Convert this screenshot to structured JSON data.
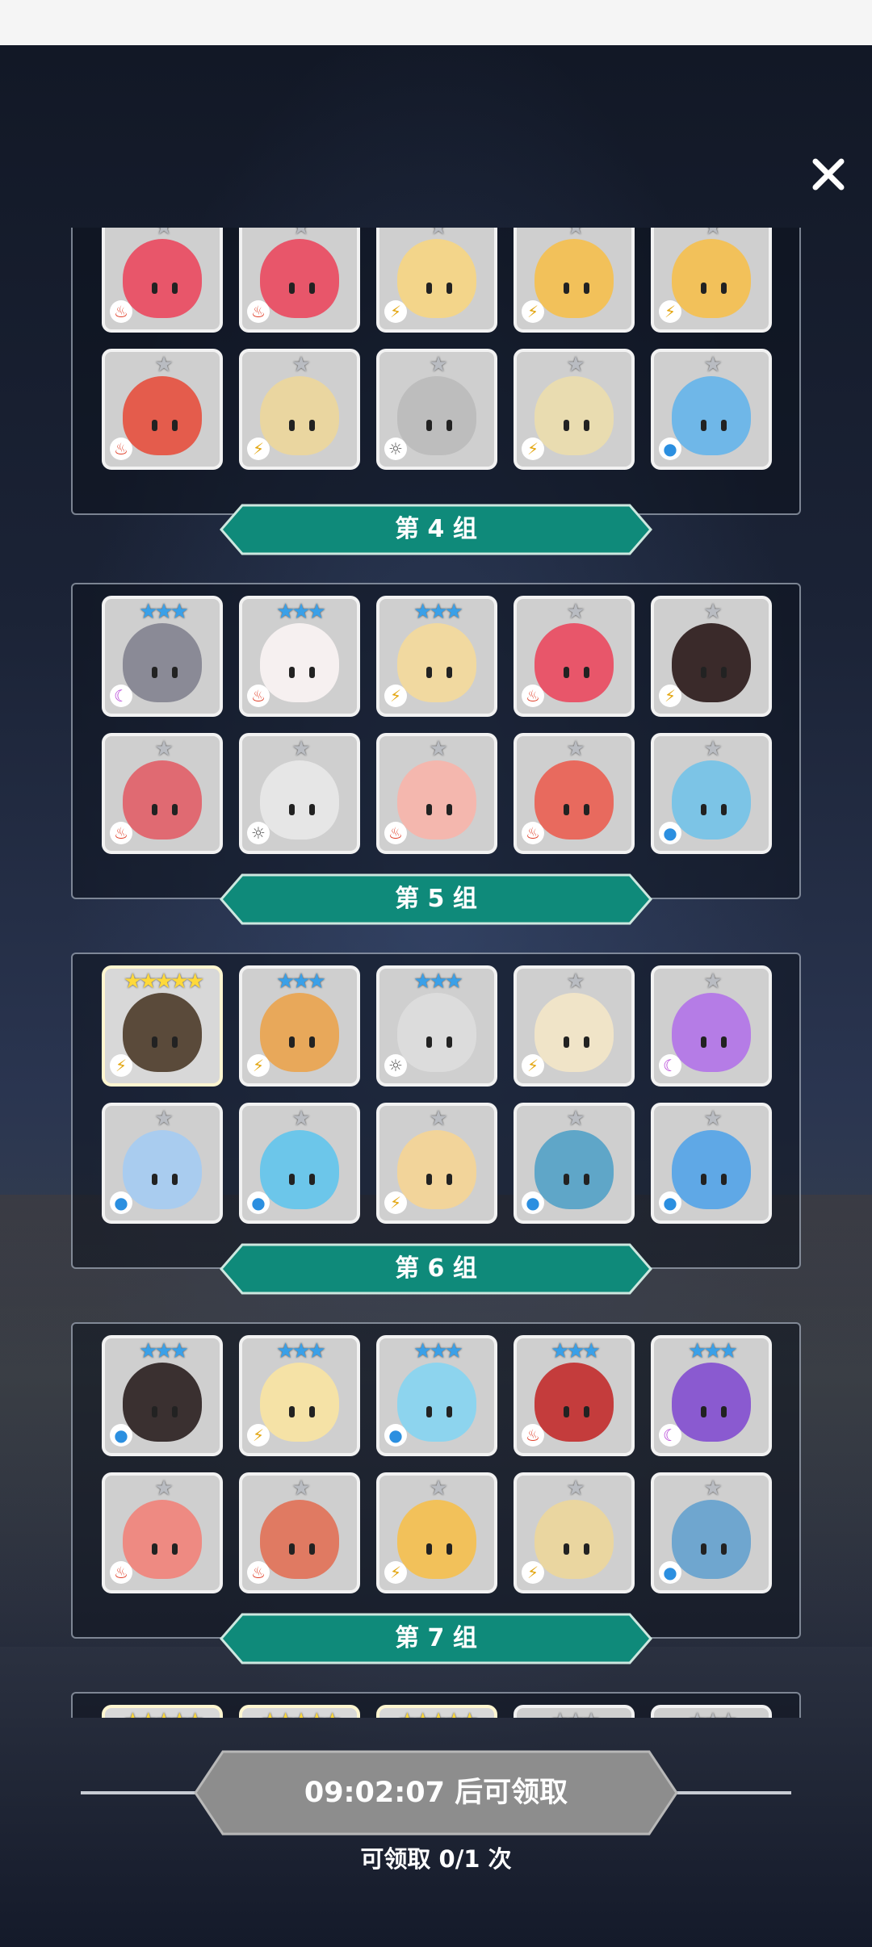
{
  "colors": {
    "banner_teal": "#0f8a7a",
    "banner_border": "#cde7df",
    "button_gray": "#8a8a8a",
    "background": "#141a2a"
  },
  "close_icon": "close-icon",
  "groups": [
    {
      "label": "第 4 组",
      "heroes": [
        {
          "stars": "★",
          "tier": "s1",
          "element": "fire",
          "color": "#e8566a"
        },
        {
          "stars": "★",
          "tier": "s1",
          "element": "fire",
          "color": "#e8566a"
        },
        {
          "stars": "★",
          "tier": "s1",
          "element": "thunder",
          "color": "#f3d58a"
        },
        {
          "stars": "★",
          "tier": "s1",
          "element": "thunder",
          "color": "#f2c15a"
        },
        {
          "stars": "★",
          "tier": "s1",
          "element": "thunder",
          "color": "#f2c15a"
        },
        {
          "stars": "★",
          "tier": "s1",
          "element": "fire",
          "color": "#e45c4c"
        },
        {
          "stars": "★",
          "tier": "s1",
          "element": "thunder",
          "color": "#ead6a0"
        },
        {
          "stars": "★",
          "tier": "s1",
          "element": "light",
          "color": "#bdbdbd"
        },
        {
          "stars": "★",
          "tier": "s1",
          "element": "thunder",
          "color": "#e9dcb0"
        },
        {
          "stars": "★",
          "tier": "s1",
          "element": "water",
          "color": "#6fb7e8"
        }
      ]
    },
    {
      "label": "第 5 组",
      "heroes": [
        {
          "stars": "★★★",
          "tier": "s3",
          "element": "dark",
          "color": "#8a8a96"
        },
        {
          "stars": "★★★",
          "tier": "s3",
          "element": "fire",
          "color": "#f6f0f0"
        },
        {
          "stars": "★★★",
          "tier": "s3",
          "element": "thunder",
          "color": "#f1d9a0"
        },
        {
          "stars": "★",
          "tier": "s1",
          "element": "fire",
          "color": "#e8566a"
        },
        {
          "stars": "★",
          "tier": "s1",
          "element": "thunder",
          "color": "#3a2a2a"
        },
        {
          "stars": "★",
          "tier": "s1",
          "element": "fire",
          "color": "#e06a72"
        },
        {
          "stars": "★",
          "tier": "s1",
          "element": "light",
          "color": "#e6e6e6"
        },
        {
          "stars": "★",
          "tier": "s1",
          "element": "fire",
          "color": "#f4b7ae"
        },
        {
          "stars": "★",
          "tier": "s1",
          "element": "fire",
          "color": "#e86a5e"
        },
        {
          "stars": "★",
          "tier": "s1",
          "element": "water",
          "color": "#7cc4e6"
        }
      ]
    },
    {
      "label": "第 6 组",
      "heroes": [
        {
          "stars": "★★★★★",
          "tier": "s5",
          "element": "thunder",
          "color": "#5a4a3a"
        },
        {
          "stars": "★★★",
          "tier": "s3",
          "element": "thunder",
          "color": "#e8a85a"
        },
        {
          "stars": "★★★",
          "tier": "s3",
          "element": "light",
          "color": "#dcdcdc"
        },
        {
          "stars": "★",
          "tier": "s1",
          "element": "thunder",
          "color": "#f0e4c8"
        },
        {
          "stars": "★",
          "tier": "s1",
          "element": "dark",
          "color": "#b57ce6"
        },
        {
          "stars": "★",
          "tier": "s1",
          "element": "water",
          "color": "#a9ccef"
        },
        {
          "stars": "★",
          "tier": "s1",
          "element": "water",
          "color": "#6cc6ea"
        },
        {
          "stars": "★",
          "tier": "s1",
          "element": "thunder",
          "color": "#f2d49a"
        },
        {
          "stars": "★",
          "tier": "s1",
          "element": "water",
          "color": "#5fa6c8"
        },
        {
          "stars": "★",
          "tier": "s1",
          "element": "water",
          "color": "#5fa8e6"
        }
      ]
    },
    {
      "label": "第 7 组",
      "heroes": [
        {
          "stars": "★★★",
          "tier": "s3",
          "element": "water",
          "color": "#3a3030"
        },
        {
          "stars": "★★★",
          "tier": "s3",
          "element": "thunder",
          "color": "#f5e2a6"
        },
        {
          "stars": "★★★",
          "tier": "s3",
          "element": "water",
          "color": "#8dd4ee"
        },
        {
          "stars": "★★★",
          "tier": "s3",
          "element": "fire",
          "color": "#c43c3c"
        },
        {
          "stars": "★★★",
          "tier": "s3",
          "element": "dark",
          "color": "#8a5ad0"
        },
        {
          "stars": "★",
          "tier": "s1",
          "element": "fire",
          "color": "#ee8a82"
        },
        {
          "stars": "★",
          "tier": "s1",
          "element": "fire",
          "color": "#e07a62"
        },
        {
          "stars": "★",
          "tier": "s1",
          "element": "thunder",
          "color": "#f2c15a"
        },
        {
          "stars": "★",
          "tier": "s1",
          "element": "thunder",
          "color": "#ead6a0"
        },
        {
          "stars": "★",
          "tier": "s1",
          "element": "water",
          "color": "#6fa6cf"
        }
      ]
    }
  ],
  "partial_group": {
    "heroes": [
      {
        "stars": "★★★★★",
        "tier": "s5",
        "element": "",
        "color": "#d8d8d8"
      },
      {
        "stars": "★★★★★",
        "tier": "s5",
        "element": "",
        "color": "#d8d8d8"
      },
      {
        "stars": "★★★★★",
        "tier": "s5",
        "element": "",
        "color": "#d8d8d8"
      },
      {
        "stars": "★★★",
        "tier": "s1",
        "element": "",
        "color": "#d8d8d8"
      },
      {
        "stars": "★★★",
        "tier": "s1",
        "element": "",
        "color": "#d8d8d8"
      }
    ]
  },
  "element_glyphs": {
    "fire": "♨",
    "water": "●",
    "thunder": "⚡",
    "light": "☼",
    "dark": "☾"
  },
  "claim": {
    "timer_label": "09:02:07 后可领取",
    "count_label": "可领取 0/1 次"
  }
}
